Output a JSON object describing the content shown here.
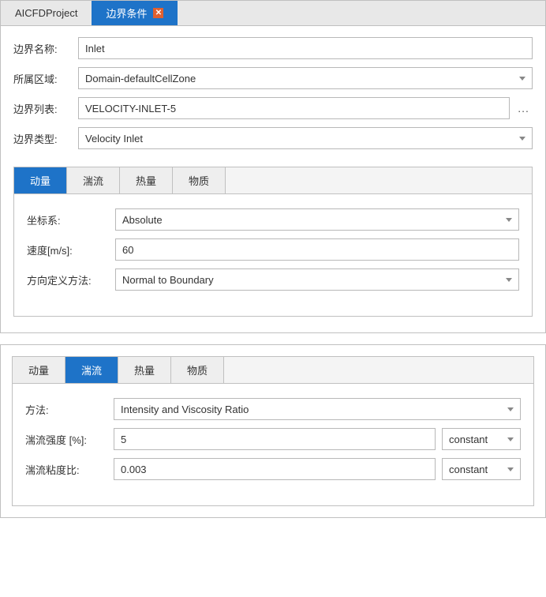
{
  "topTabs": {
    "project": "AICFDProject",
    "boundary": "边界条件"
  },
  "form": {
    "name_label": "边界名称:",
    "name_value": "Inlet",
    "domain_label": "所属区域:",
    "domain_value": "Domain-defaultCellZone",
    "list_label": "边界列表:",
    "list_value": "VELOCITY-INLET-5",
    "type_label": "边界类型:",
    "type_value": "Velocity Inlet"
  },
  "subtabs": {
    "momentum": "动量",
    "turbulence": "湍流",
    "thermal": "热量",
    "species": "物质"
  },
  "momentum": {
    "coord_label": "坐标系:",
    "coord_value": "Absolute",
    "velocity_label": "速度[m/s]:",
    "velocity_value": "60",
    "direction_label": "方向定义方法:",
    "direction_value": "Normal to Boundary"
  },
  "turbulence": {
    "method_label": "方法:",
    "method_value": "Intensity and Viscosity Ratio",
    "intensity_label": "湍流强度 [%]:",
    "intensity_value": "5",
    "intensity_mode": "constant",
    "viscratio_label": "湍流粘度比:",
    "viscratio_value": "0.003",
    "viscratio_mode": "constant"
  }
}
